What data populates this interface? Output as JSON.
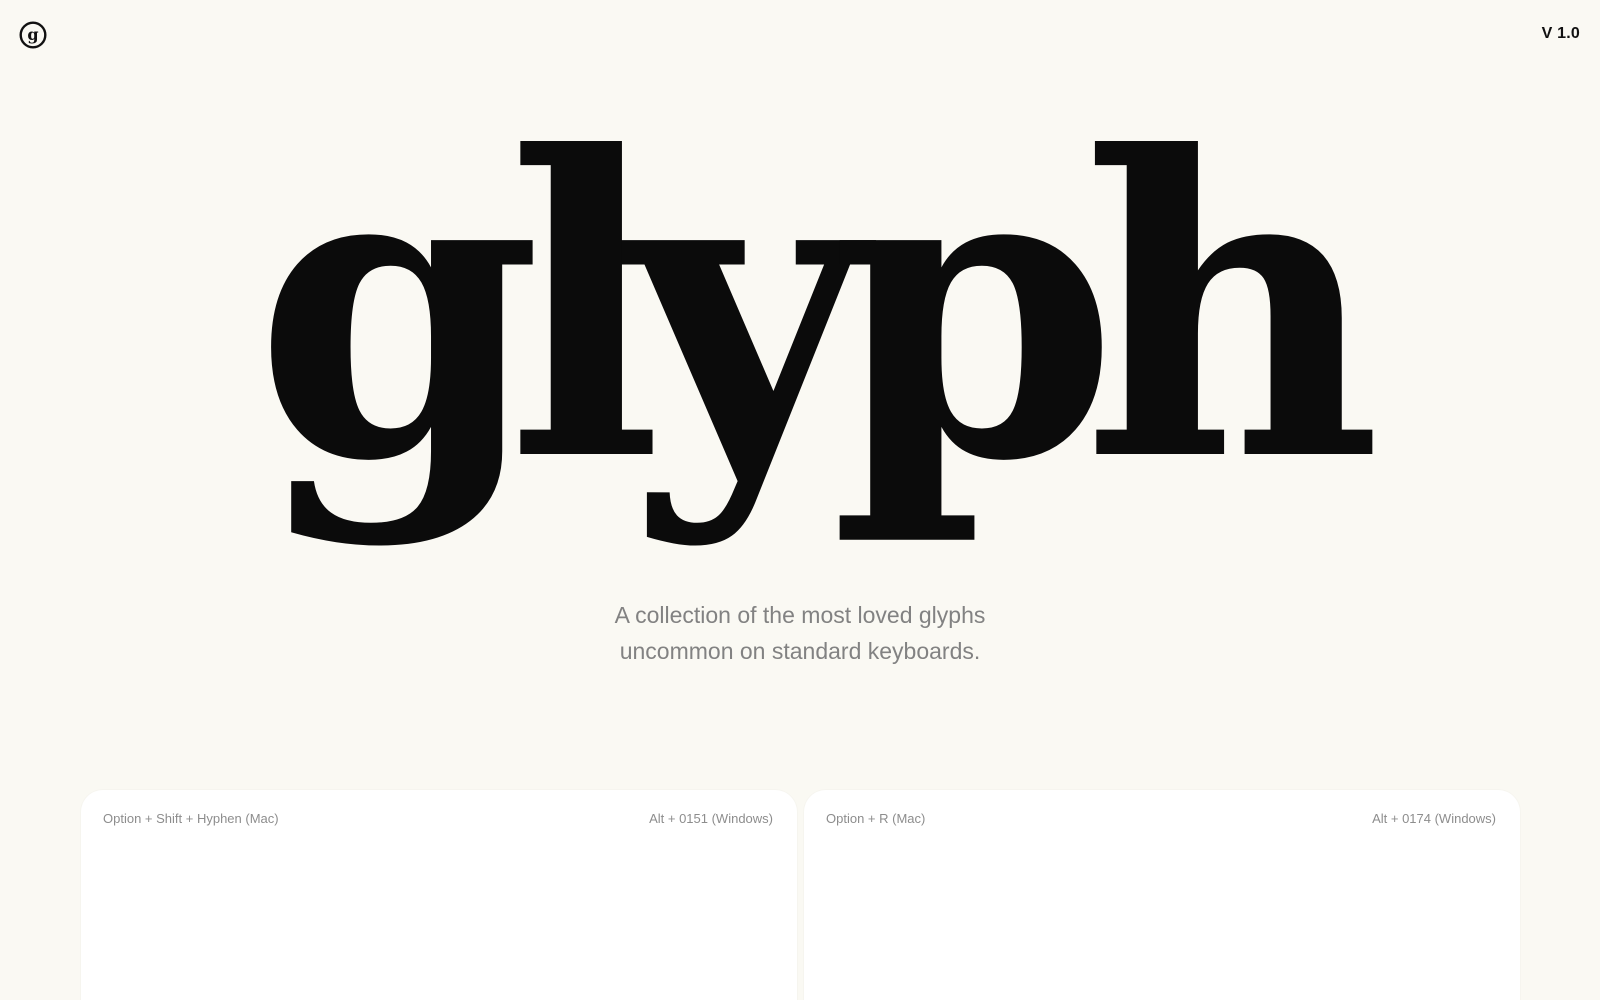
{
  "header": {
    "logo_icon": "g-circle-logo-icon",
    "version": "V 1.0"
  },
  "hero": {
    "wordmark": "glyph",
    "tagline_line1": "A collection of the most loved glyphs",
    "tagline_line2": "uncommon on standard keyboards."
  },
  "cards": [
    {
      "mac_shortcut": "Option + Shift + Hyphen (Mac)",
      "windows_shortcut": "Alt + 0151 (Windows)"
    },
    {
      "mac_shortcut": "Option + R (Mac)",
      "windows_shortcut": "Alt + 0174 (Windows)"
    }
  ],
  "colors": {
    "background": "#faf9f3",
    "text": "#0b0b0b",
    "muted": "#828282",
    "card": "#ffffff"
  }
}
